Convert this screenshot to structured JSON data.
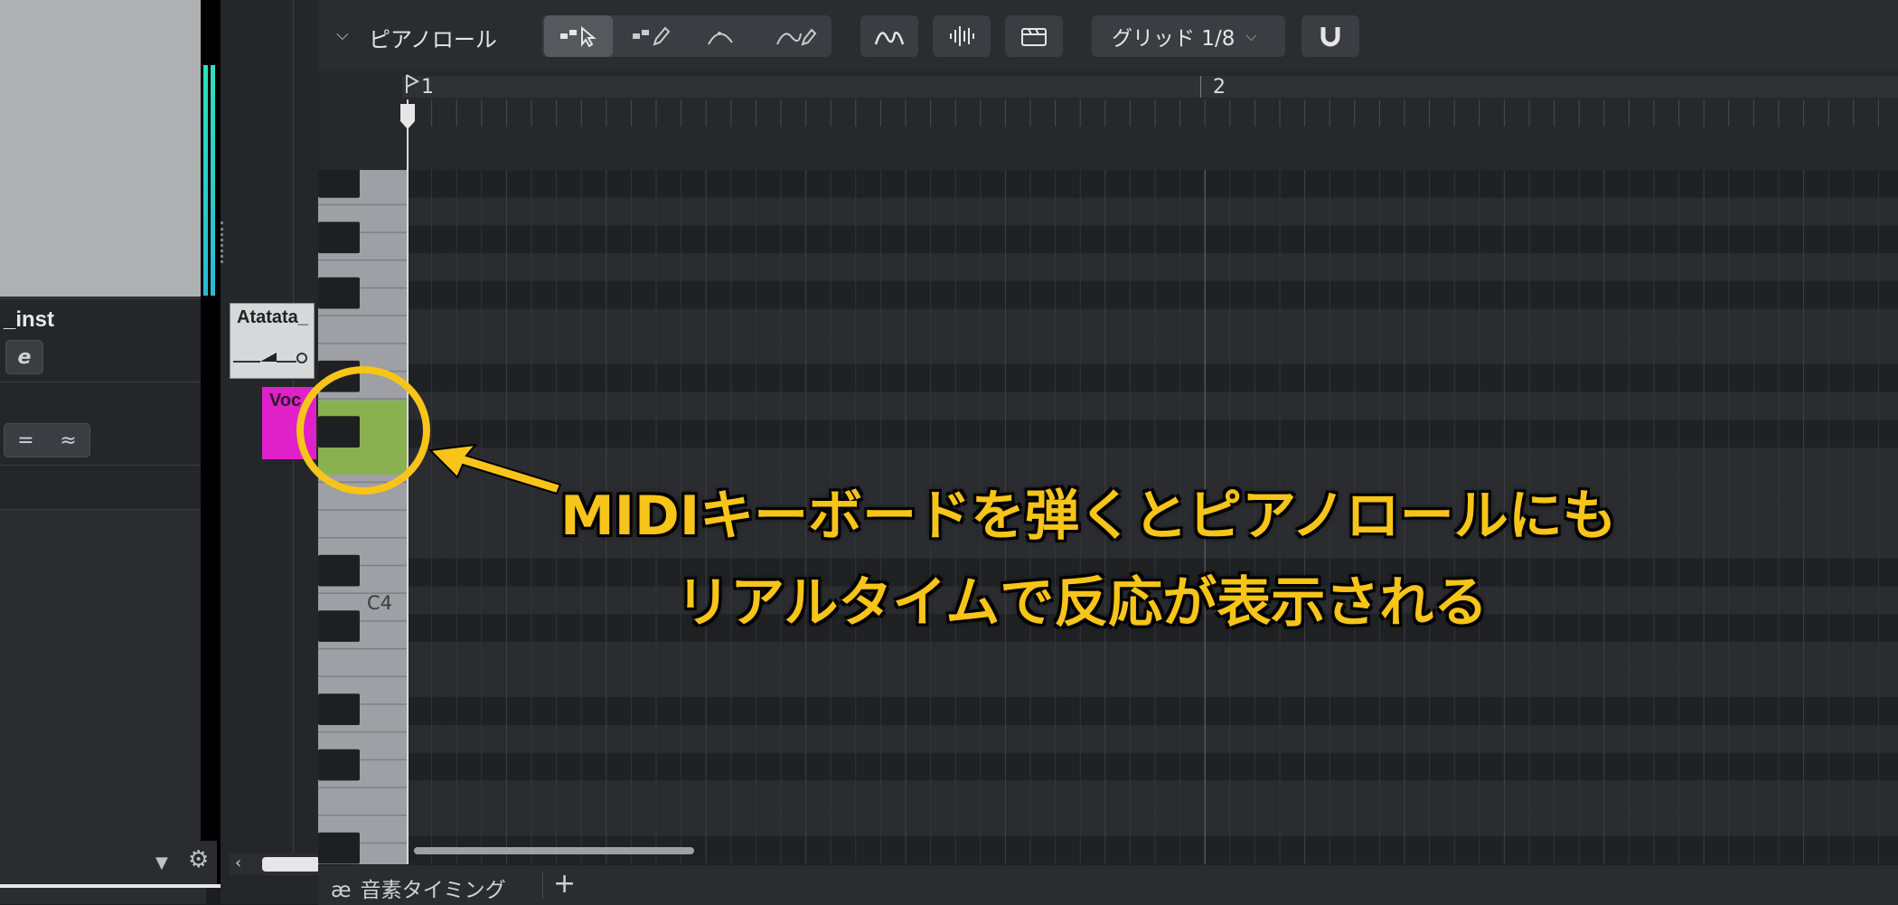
{
  "left_panel": {
    "track_name": "_inst",
    "edit_button_label": "e",
    "row2_buttons": [
      "=",
      "≈"
    ]
  },
  "arrange": {
    "clips": [
      {
        "label": "Atatata_",
        "color": "#d6d8da"
      },
      {
        "label": "Voc",
        "color": "#e020c8"
      }
    ]
  },
  "toolbar": {
    "title": "ピアノロール",
    "tool_icons": [
      "select-arrow-icon",
      "draw-pencil-icon",
      "curve-tool-icon",
      "freehand-curve-icon"
    ],
    "view_icons": [
      "pitch-curve-icon",
      "waveform-icon",
      "clapper-icon"
    ],
    "grid_label": "グリッド 1/8",
    "snap_icon": "magnet-icon"
  },
  "ruler": {
    "bar_labels": [
      "1",
      "2"
    ]
  },
  "keyboard": {
    "note_label": "C4",
    "pressed_key_color": "#8ab14f"
  },
  "footer": {
    "tab_label": "音素タイミング",
    "add_label": "+"
  },
  "annotation": {
    "line1": "MIDIキーボードを弾くとピアノロールにも",
    "line2": "リアルタイムで反応が表示される",
    "color": "#f7c419"
  }
}
